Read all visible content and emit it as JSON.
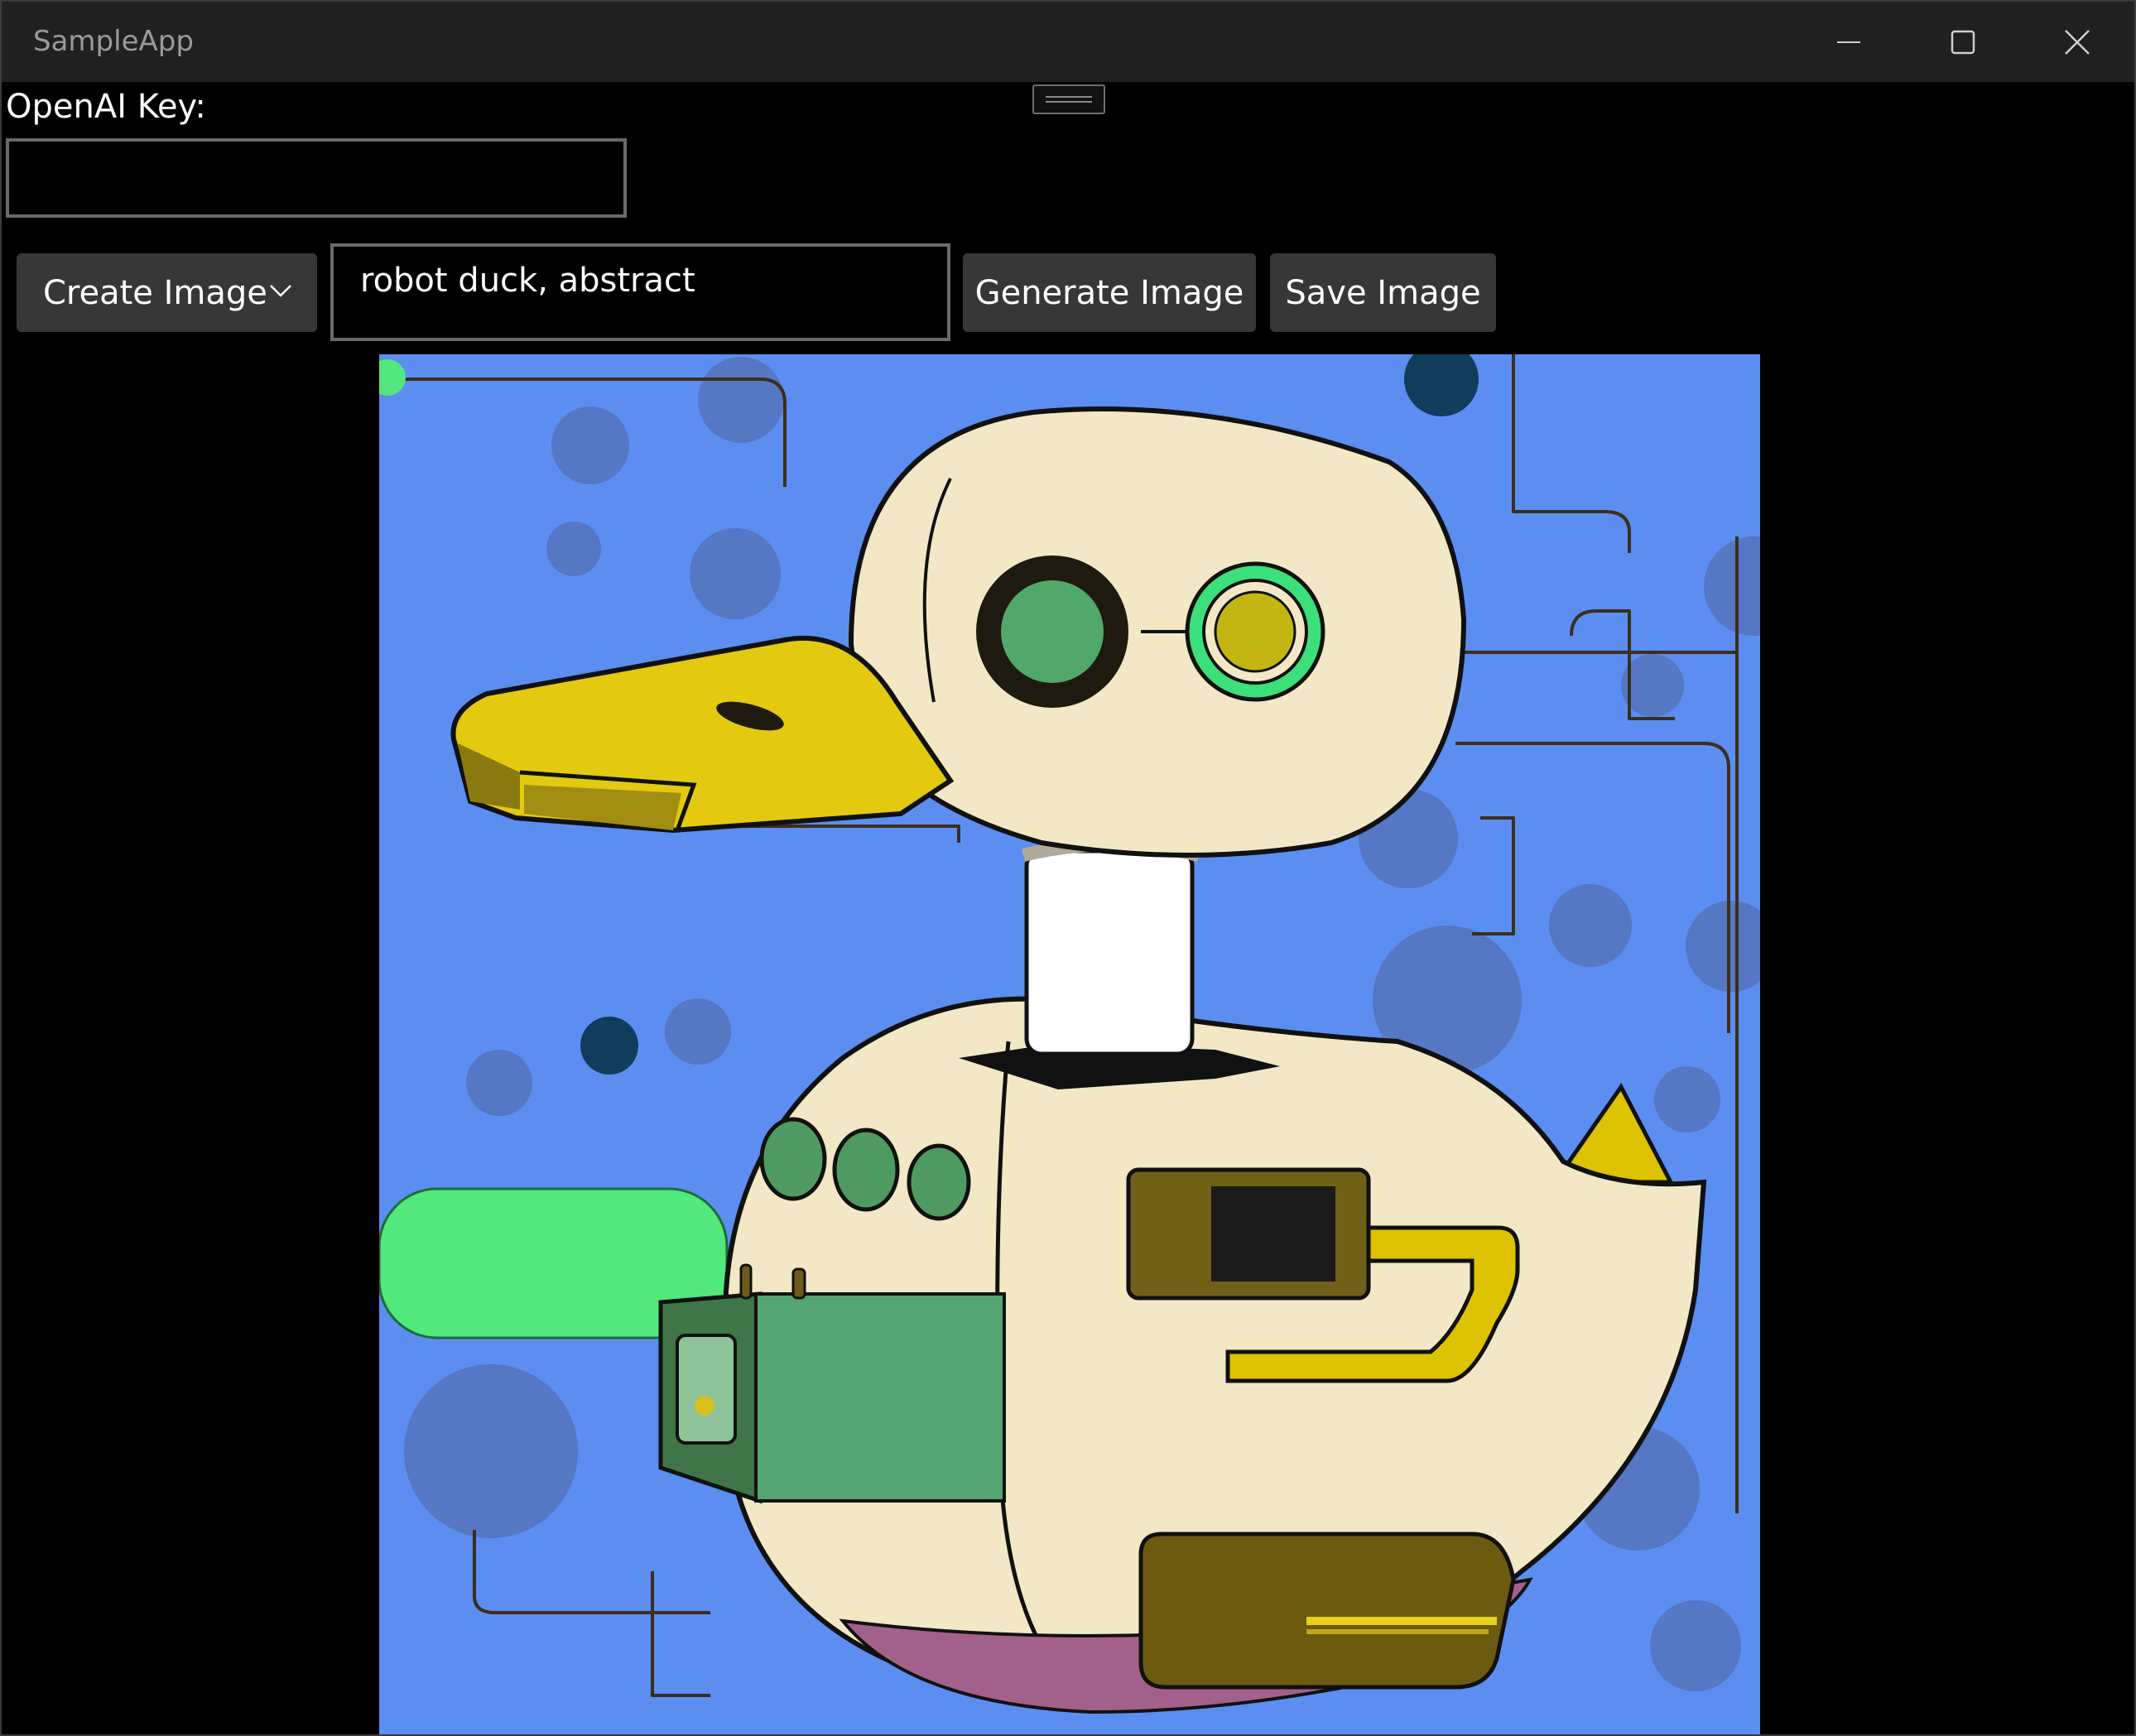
{
  "window": {
    "title": "SampleApp"
  },
  "form": {
    "key_label": "OpenAI Key:",
    "key_value": "",
    "mode_selected": "Create Image",
    "prompt_value": "robot duck, abstract",
    "generate_label": "Generate Image",
    "save_label": "Save Image"
  },
  "icons": {
    "minimize": "minimize-icon",
    "maximize": "maximize-icon",
    "close": "close-icon",
    "dropdown": "chevron-down-icon"
  },
  "colors": {
    "titlebar": "#202020",
    "background": "#000000",
    "button": "#373737",
    "image_sky": "#5b8ef0"
  }
}
